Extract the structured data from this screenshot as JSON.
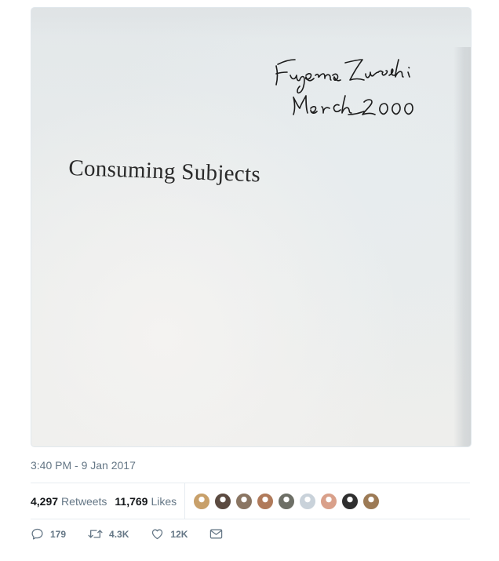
{
  "photo": {
    "book_title": "Consuming Subjects",
    "signature_name": "Eugenia Zuroski",
    "signature_date": "March 2000"
  },
  "tweet": {
    "timestamp": "3:40 PM - 9 Jan 2017",
    "retweets_count": "4,297",
    "retweets_label": "Retweets",
    "likes_count": "11,769",
    "likes_label": "Likes"
  },
  "liked_by_avatars": [
    {
      "color": "#c8a06a"
    },
    {
      "color": "#5b4a40"
    },
    {
      "color": "#8a7562"
    },
    {
      "color": "#b07a5a"
    },
    {
      "color": "#6d6f66"
    },
    {
      "color": "#c9d2da"
    },
    {
      "color": "#d9a08a"
    },
    {
      "color": "#2f2f2f"
    },
    {
      "color": "#9c7a55"
    }
  ],
  "actions": {
    "reply_icon": "reply-icon",
    "reply_count": "179",
    "retweet_icon": "retweet-icon",
    "retweet_count": "4.3K",
    "like_icon": "heart-icon",
    "like_count": "12K",
    "dm_icon": "envelope-icon"
  },
  "colors": {
    "secondary_text": "#657786",
    "divider": "#e6ecf0"
  }
}
